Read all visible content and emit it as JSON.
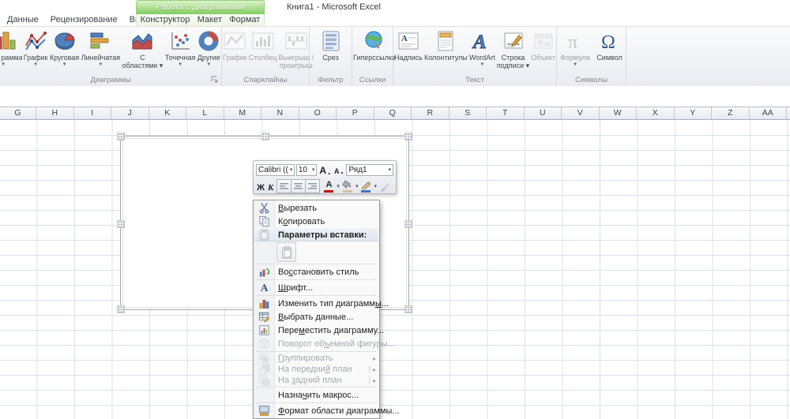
{
  "window": {
    "title": "Книга1  -  Microsoft Excel"
  },
  "contextual_tab_header": "Работа с диаграммами",
  "tabs": [
    {
      "id": "data",
      "label": "Данные"
    },
    {
      "id": "review",
      "label": "Рецензирование"
    },
    {
      "id": "view",
      "label": "Вид"
    },
    {
      "id": "design",
      "label": "Конструктор",
      "contextual": true
    },
    {
      "id": "layout",
      "label": "Макет",
      "contextual": true
    },
    {
      "id": "format",
      "label": "Формат",
      "contextual": true
    }
  ],
  "ribbon": {
    "groups": [
      {
        "id": "charts",
        "label": "Диаграммы",
        "dialog_launcher": true,
        "items": [
          {
            "icon": "column-chart-3d-icon",
            "lines": [
              "рамма"
            ],
            "arrow": true,
            "partial": true
          },
          {
            "icon": "line-chart-icon",
            "lines": [
              "График"
            ],
            "arrow": true
          },
          {
            "icon": "pie-chart-icon",
            "lines": [
              "Круговая"
            ],
            "arrow": true
          },
          {
            "icon": "bar-chart-icon",
            "lines": [
              "Линейчатая"
            ],
            "arrow": true
          },
          {
            "icon": "area-chart-icon",
            "lines": [
              "С",
              "областями"
            ],
            "arrow": true
          },
          {
            "icon": "scatter-chart-icon",
            "lines": [
              "Точечная"
            ],
            "arrow": true
          },
          {
            "icon": "donut-chart-icon",
            "lines": [
              "Другие"
            ],
            "arrow": true
          }
        ]
      },
      {
        "id": "sparklines",
        "label": "Спарклайны",
        "items": [
          {
            "icon": "sparkline-line-icon",
            "lines": [
              "График"
            ],
            "disabled": true
          },
          {
            "icon": "sparkline-column-icon",
            "lines": [
              "Столбец"
            ],
            "disabled": true
          },
          {
            "icon": "sparkline-winloss-icon",
            "lines": [
              "Выигрыш /",
              "проигрыш"
            ],
            "disabled": true
          }
        ]
      },
      {
        "id": "filter",
        "label": "Фильтр",
        "items": [
          {
            "icon": "slicer-icon",
            "lines": [
              "Срез"
            ]
          }
        ]
      },
      {
        "id": "links",
        "label": "Ссылки",
        "items": [
          {
            "icon": "hyperlink-globe-icon",
            "lines": [
              "Гиперссылка"
            ]
          }
        ]
      },
      {
        "id": "text",
        "label": "Текст",
        "items": [
          {
            "icon": "textbox-icon",
            "lines": [
              "Надпись"
            ]
          },
          {
            "icon": "header-footer-icon",
            "lines": [
              "Колонтитулы"
            ]
          },
          {
            "icon": "wordart-icon",
            "lines": [
              "WordArt"
            ],
            "arrow": true
          },
          {
            "icon": "signature-line-icon",
            "lines": [
              "Строка",
              "подписи"
            ],
            "arrow": true
          },
          {
            "icon": "object-icon",
            "lines": [
              "Объект"
            ],
            "disabled": true
          }
        ]
      },
      {
        "id": "symbols",
        "label": "Символы",
        "items": [
          {
            "icon": "equation-pi-icon",
            "lines": [
              "Формула"
            ],
            "arrow": true,
            "disabled": true
          },
          {
            "icon": "omega-symbol-icon",
            "lines": [
              "Символ"
            ]
          }
        ]
      }
    ]
  },
  "sheet": {
    "columns": [
      "G",
      "H",
      "I",
      "J",
      "K",
      "L",
      "M",
      "N",
      "O",
      "P",
      "Q",
      "R",
      "S",
      "T",
      "U",
      "V",
      "W",
      "X",
      "Y",
      "Z",
      "AA"
    ]
  },
  "mini_toolbar": {
    "font_name": "Calibri ((",
    "font_size": "10",
    "chart_element": "Ряд1",
    "grow_font_label": "А",
    "shrink_font_label": "А",
    "bold_label": "Ж",
    "italic_label": "К"
  },
  "context_menu": {
    "items": [
      {
        "id": "cut",
        "icon": "cut-icon",
        "label": "Вырезать",
        "accel": 0
      },
      {
        "id": "copy",
        "icon": "copy-icon",
        "label": "Копировать",
        "accel": 1
      },
      {
        "id": "paste-options-header",
        "icon": "clipboard-icon",
        "label": "Параметры вставки:",
        "highlight": true
      },
      {
        "id": "paste-option",
        "icon": "paste-option-icon",
        "paste_row": true
      },
      {
        "sep": true
      },
      {
        "id": "reset-style",
        "icon": "reset-style-icon",
        "label": "Восстановить стиль",
        "accel": 2
      },
      {
        "sep": true
      },
      {
        "id": "font",
        "icon": "font-icon",
        "label": "Шрифт...",
        "accel": 0
      },
      {
        "sep": true
      },
      {
        "id": "change-chart-type",
        "icon": "change-chart-type-icon",
        "label": "Изменить тип диаграммы...",
        "accel": 21
      },
      {
        "id": "select-data",
        "icon": "select-data-icon",
        "label": "Выбрать данные...",
        "accel": 0
      },
      {
        "id": "move-chart",
        "icon": "move-chart-icon",
        "label": "Переместить диаграмму...",
        "accel": 4
      },
      {
        "id": "rotate-3d",
        "icon": "rotate-3d-icon",
        "label": "Поворот объемной фигуры...",
        "accel": 10,
        "disabled": true
      },
      {
        "sep": true
      },
      {
        "id": "group",
        "icon": "group-icon",
        "label": "Группировать",
        "accel": 0,
        "disabled": true,
        "submenu": true,
        "small": true
      },
      {
        "id": "bring-to-front",
        "icon": "bring-front-icon",
        "label": "На передний план",
        "accel": 10,
        "disabled": true,
        "submenu": true,
        "split": true,
        "small": true
      },
      {
        "id": "send-to-back",
        "icon": "send-back-icon",
        "label": "На задний план",
        "accel": 3,
        "disabled": true,
        "submenu": true,
        "split": true,
        "small": true
      },
      {
        "sep": true
      },
      {
        "id": "assign-macro",
        "label": "Назначить макрос...",
        "accel": 5
      },
      {
        "sep": true
      },
      {
        "id": "format-chart-area",
        "icon": "format-area-icon",
        "label": "Формат области диаграммы...",
        "accel": 0
      }
    ]
  }
}
